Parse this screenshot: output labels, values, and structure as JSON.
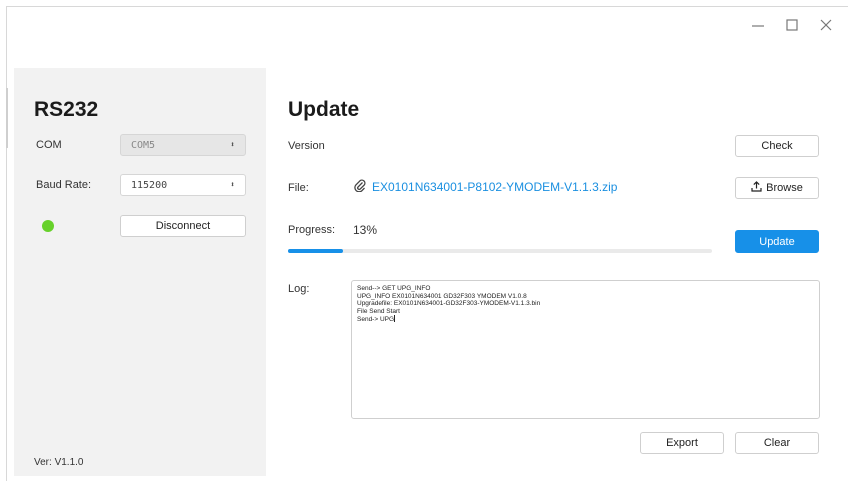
{
  "window": {
    "controls": [
      "minimize",
      "maximize",
      "close"
    ]
  },
  "left": {
    "title": "RS232",
    "com_label": "COM",
    "com_value": "COM5",
    "baud_label": "Baud Rate:",
    "baud_value": "115200",
    "status_color": "#67d12b",
    "disconnect_label": "Disconnect",
    "version": "Ver: V1.1.0"
  },
  "main": {
    "title": "Update",
    "version_label": "Version",
    "check_label": "Check",
    "file_label": "File:",
    "file_name": "EX0101N634001-P8102-YMODEM-V1.1.3.zip",
    "browse_label": "Browse",
    "progress_label": "Progress:",
    "progress_text": "13%",
    "progress_value": 0.13,
    "update_label": "Update",
    "log_label": "Log:",
    "log_lines": [
      "Send--> GET UPG_INFO",
      "UPG_INFO EX0101N634001 GD32F303 YMODEM V1.0.8",
      "Upgradefile: EX0101N634001-GD32F303-YMODEM-V1.1.3.bin",
      "File Send Start",
      "Send-> UPG"
    ],
    "export_label": "Export",
    "clear_label": "Clear"
  },
  "colors": {
    "accent": "#1790e8",
    "link": "#1a8fe0",
    "panel_bg": "#f2f2f2"
  }
}
